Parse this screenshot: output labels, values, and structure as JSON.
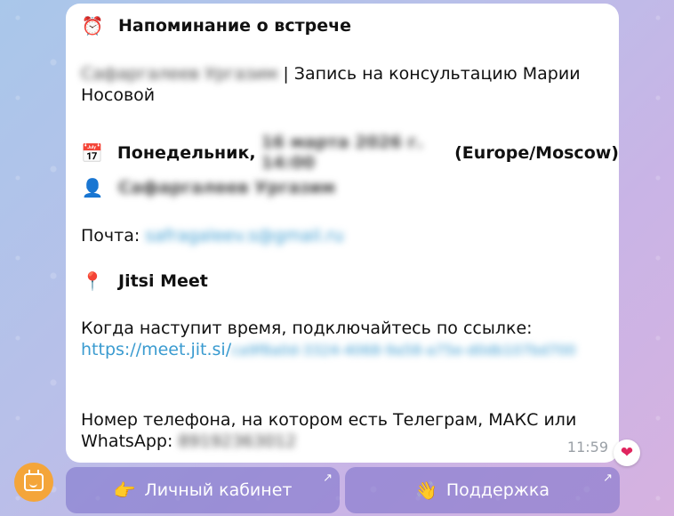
{
  "message": {
    "title_icon": "alarm-clock-icon",
    "title_emoji": "⏰",
    "title": "Напоминание о встрече",
    "client_name_blurred": "Сафаргалеев Ургазим",
    "service_sep": "| ",
    "service_line1": "Запись на консультацию Марии",
    "service_line2": "Носовой",
    "date_icon": "calendar-icon",
    "date_emoji": "📅",
    "date_prefix": "Понедельник,",
    "date_blurred": "16 марта 2026 г. 14:00",
    "date_timezone": "(Europe/Moscow)",
    "person_icon": "person-icon",
    "person_emoji": "👤",
    "person_blurred": "Сафаргалеев Ургазим",
    "email_label": "Почта:",
    "email_blurred": "safragaleev.s@gmail.ru",
    "place_icon": "pin-icon",
    "place_emoji": "📍",
    "place": "Jitsi Meet",
    "connect_text": "Когда наступит время, подключайтесь по ссылке:",
    "link_visible": "https://meet.jit.si/",
    "link_blurred": "ca9f8a0d-3324-4068-9a58-a75e-d0db107bd700",
    "phone_text_line1": "Номер телефона, на котором есть Телеграм, МАКС или",
    "phone_text_line2": "WhatsApp:",
    "phone_blurred": "89192363012",
    "time": "11:59",
    "reaction": "❤"
  },
  "keyboard": {
    "cabinet_emoji": "👉",
    "cabinet_label": "Личный кабинет",
    "support_emoji": "👋",
    "support_label": "Поддержка",
    "arrow": "↗"
  },
  "colors": {
    "link": "#3a9bd0",
    "accent_orange": "#f4a53a",
    "keyboard_button": "#8b80cc"
  }
}
